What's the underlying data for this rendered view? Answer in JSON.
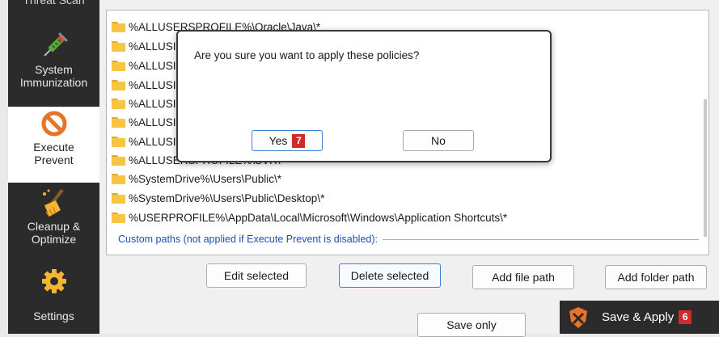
{
  "sidebar": {
    "top_partial_label": "Threat Scan",
    "items": [
      {
        "label": "System\nImmunization",
        "icon": "syringe-icon"
      },
      {
        "label": "Execute\nPrevent",
        "icon": "prohibited-icon"
      },
      {
        "label": "Cleanup &\nOptimize",
        "icon": "broom-icon"
      },
      {
        "label": "Settings",
        "icon": "gear-icon"
      }
    ]
  },
  "paths": [
    "%ALLUSERSPROFILE%\\Oracle\\Java\\*",
    "%ALLUSI",
    "%ALLUSI",
    "%ALLUSI",
    "%ALLUSI",
    "%ALLUSI",
    "%ALLUSI",
    "%ALLUSERSPROFILE%\\SVR\\*",
    "%SystemDrive%\\Users\\Public\\*",
    "%SystemDrive%\\Users\\Public\\Desktop\\*",
    "%USERPROFILE%\\AppData\\Local\\Microsoft\\Windows\\Application Shortcuts\\*"
  ],
  "custom_paths_label": "Custom paths (not applied if Execute Prevent is disabled):",
  "buttons": {
    "edit_selected": "Edit selected",
    "delete_selected": "Delete selected",
    "add_file_path": "Add file path",
    "add_folder_path": "Add folder path",
    "save_only": "Save only",
    "save_apply": "Save & Apply",
    "save_apply_badge": "6"
  },
  "dialog": {
    "message": "Are you sure you want to apply these policies?",
    "yes_label": "Yes",
    "yes_badge": "7",
    "no_label": "No"
  },
  "colors": {
    "sidebar_bg": "#2b2b2b",
    "accent_orange": "#e8742a",
    "badge_red": "#d02a2a",
    "link_blue": "#1f4fb0"
  }
}
